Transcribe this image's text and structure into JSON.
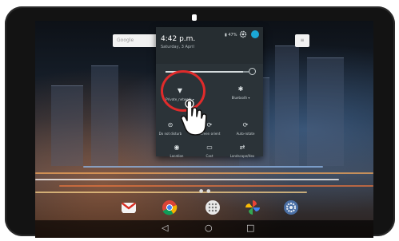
{
  "home": {
    "search_label": "Google",
    "widget_label": "≡"
  },
  "quick_settings": {
    "time": "4:42 p.m.",
    "date": "Saturday, 3 April",
    "battery": "▮ 47%",
    "tiles": [
      {
        "label": "Private_network ▾",
        "glyph": "▼"
      },
      {
        "label": "Bluetooth ▾",
        "glyph": "✱"
      },
      {
        "label": "Do not disturb",
        "glyph": "⊝"
      },
      {
        "label": "Screen orient",
        "glyph": "⟳"
      },
      {
        "label": "Auto-rotate",
        "glyph": "⟳"
      },
      {
        "label": "Location",
        "glyph": "◉"
      },
      {
        "label": "Cast",
        "glyph": "▭"
      },
      {
        "label": "Landscape/Hex",
        "glyph": "⇄"
      }
    ]
  },
  "brightness": {
    "level": 0.93
  },
  "dock": {
    "page_dots": "● ●",
    "nav": {
      "back": "◁",
      "home": "○",
      "recent": "□"
    }
  },
  "colors": {
    "accent": "#1ba7d6",
    "highlight": "#e02b2b",
    "panel": "#2b3338"
  }
}
